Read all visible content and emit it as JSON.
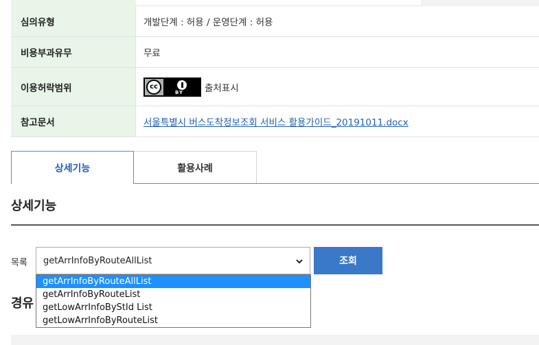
{
  "info": {
    "rows": [
      {
        "label": "심의유형",
        "value": "개발단계 : 허용 / 운영단계 : 허용"
      },
      {
        "label": "비용부과유무",
        "value": "무료"
      },
      {
        "label": "이용허락범위",
        "value": "출처표시",
        "badge": "cc-by-badge"
      },
      {
        "label": "참고문서",
        "value": "서울특별시 버스도착정보조회 서비스 활용가이드_20191011.docx"
      }
    ],
    "badge_text": {
      "cc": "cc",
      "by": "BY"
    }
  },
  "tabs": [
    {
      "label": "상세기능",
      "active": true
    },
    {
      "label": "활용사례",
      "active": false
    }
  ],
  "section": {
    "title": "상세기능"
  },
  "list": {
    "label": "목록",
    "selected": "getArrInfoByRouteAllList",
    "button": "조회",
    "options": [
      "getArrInfoByRouteAllList",
      "getArrInfoByRouteList",
      "getLowArrInfoByStId List",
      "getLowArrInfoByRouteList"
    ]
  },
  "sub_section": {
    "title": "경유"
  },
  "colors": {
    "header_bg": "#e8f5e8",
    "accent": "#3a78c9",
    "link": "#1f5fb8",
    "dropdown_highlight": "#1e90ff"
  }
}
